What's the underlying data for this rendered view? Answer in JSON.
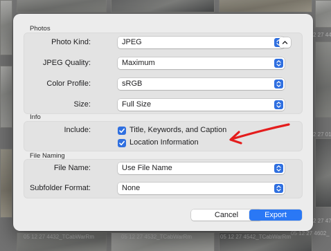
{
  "background": {
    "filenames": [
      "05 12 27 4432_TCabWarRm",
      "05 12 27 4532_TCabWarRm",
      "05 12 27 4542_TCabWarRm",
      "05 12 27 4602_",
      "2 27 4432",
      "2 27 016",
      "2 27 473"
    ]
  },
  "dialog": {
    "photos_section": {
      "title": "Photos",
      "rows": [
        {
          "label": "Photo Kind:",
          "value": "JPEG"
        },
        {
          "label": "JPEG Quality:",
          "value": "Maximum"
        },
        {
          "label": "Color Profile:",
          "value": "sRGB"
        },
        {
          "label": "Size:",
          "value": "Full Size"
        }
      ]
    },
    "info_section": {
      "title": "Info",
      "include_label": "Include:",
      "checkboxes": [
        {
          "label": "Title, Keywords, and Caption",
          "checked": true
        },
        {
          "label": "Location Information",
          "checked": true
        }
      ]
    },
    "naming_section": {
      "title": "File Naming",
      "rows": [
        {
          "label": "File Name:",
          "value": "Use File Name"
        },
        {
          "label": "Subfolder Format:",
          "value": "None"
        }
      ]
    },
    "buttons": {
      "cancel": "Cancel",
      "export": "Export"
    }
  },
  "colors": {
    "accent": "#2a78f5",
    "annotation_arrow": "#e41d1d"
  },
  "icons": {
    "stepper": "up-down-chevron-icon",
    "disclosure": "chevron-up-icon",
    "checkmark": "checkmark-icon",
    "annotation": "red-arrow-annotation"
  }
}
